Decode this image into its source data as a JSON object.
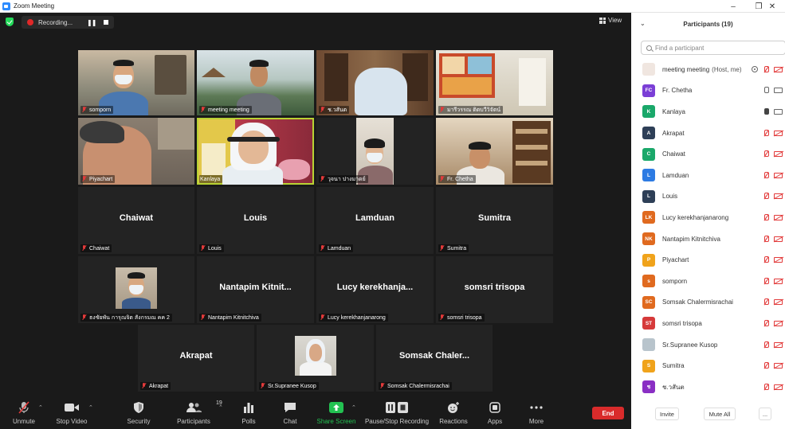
{
  "window": {
    "title": "Zoom Meeting"
  },
  "recording": {
    "label": "Recording..."
  },
  "view": {
    "label": "View"
  },
  "tiles": [
    {
      "name": "somporn",
      "video": true
    },
    {
      "name": "meeting meeting",
      "video": true
    },
    {
      "name": "ช.วสันต",
      "video": true
    },
    {
      "name": "มารีวรรณ  ติตบวีวิจัตน์",
      "video": true
    },
    {
      "name": "Piyachart",
      "video": true
    },
    {
      "name": "Kanlaya",
      "video": true,
      "active": true
    },
    {
      "name": "วุจนา ปางมาดย์",
      "video": true
    },
    {
      "name": "Fr. Chetha",
      "video": true
    },
    {
      "name": "Chaiwat",
      "display": "Chaiwat",
      "video": false
    },
    {
      "name": "Louis",
      "display": "Louis",
      "video": false
    },
    {
      "name": "Lamduan",
      "display": "Lamduan",
      "video": false
    },
    {
      "name": "Sumitra",
      "display": "Sumitra",
      "video": false
    },
    {
      "name": "ธงชัยพัน การุณจิต สังกรมณ คค 2",
      "video": true
    },
    {
      "name": "Nantapim Kitnitchiva",
      "display": "Nantapim  Kitnit...",
      "video": false
    },
    {
      "name": "Lucy kerekhanjanarong",
      "display": "Lucy  kerekhanja...",
      "video": false
    },
    {
      "name": "somsri trisopa",
      "display": "somsri trisopa",
      "video": false
    },
    {
      "name": "Akrapat",
      "display": "Akrapat",
      "video": false
    },
    {
      "name": "Sr.Supranee Kusop",
      "video": true
    },
    {
      "name": "Somsak Chalermisrachai",
      "display": "Somsak  Chaler...",
      "video": false
    }
  ],
  "toolbar": {
    "unmute": "Unmute",
    "stop_video": "Stop Video",
    "security": "Security",
    "participants": "Participants",
    "participants_count": "19",
    "polls": "Polls",
    "chat": "Chat",
    "share_screen": "Share Screen",
    "record": "Pause/Stop Recording",
    "reactions": "Reactions",
    "apps": "Apps",
    "more": "More",
    "end": "End"
  },
  "panel": {
    "title": "Participants (19)",
    "search_placeholder": "Find a participant",
    "participants": [
      {
        "name": "meeting meeting",
        "suffix": "(Host, me)",
        "initials": "",
        "color": "#f0e6e0",
        "mic": "muted",
        "cam": "off",
        "share": true
      },
      {
        "name": "Fr. Chetha",
        "initials": "FC",
        "color": "#7b3fd6",
        "mic": "on",
        "cam": "on"
      },
      {
        "name": "Kanlaya",
        "initials": "K",
        "color": "#1aa86a",
        "mic": "active",
        "cam": "on"
      },
      {
        "name": "Akrapat",
        "initials": "A",
        "color": "#2e3f57",
        "mic": "muted",
        "cam": "off"
      },
      {
        "name": "Chaiwat",
        "initials": "C",
        "color": "#1aa86a",
        "mic": "muted",
        "cam": "off"
      },
      {
        "name": "Lamduan",
        "initials": "L",
        "color": "#2d7be3",
        "mic": "muted",
        "cam": "off"
      },
      {
        "name": "Louis",
        "initials": "L",
        "color": "#2e3f57",
        "mic": "muted",
        "cam": "off"
      },
      {
        "name": "Lucy kerekhanjanarong",
        "initials": "LK",
        "color": "#e06a1f",
        "mic": "muted",
        "cam": "off"
      },
      {
        "name": "Nantapim Kitnitchiva",
        "initials": "NK",
        "color": "#e06a1f",
        "mic": "muted",
        "cam": "off"
      },
      {
        "name": "Piyachart",
        "initials": "P",
        "color": "#f0a31b",
        "mic": "muted",
        "cam": "off"
      },
      {
        "name": "somporn",
        "initials": "s",
        "color": "#e06a1f",
        "mic": "muted",
        "cam": "off"
      },
      {
        "name": "Somsak Chalermisrachai",
        "initials": "SC",
        "color": "#e06a1f",
        "mic": "muted",
        "cam": "off"
      },
      {
        "name": "somsri trisopa",
        "initials": "ST",
        "color": "#d63a3a",
        "mic": "muted",
        "cam": "off"
      },
      {
        "name": "Sr.Supranee Kusop",
        "initials": "",
        "color": "#b8c4cc",
        "mic": "muted",
        "cam": "off"
      },
      {
        "name": "Sumitra",
        "initials": "S",
        "color": "#f0a31b",
        "mic": "muted",
        "cam": "off"
      },
      {
        "name": "ช.วสันต",
        "initials": "ช",
        "color": "#8a2fc4",
        "mic": "muted",
        "cam": "off"
      }
    ],
    "invite": "Invite",
    "mute_all": "Mute All",
    "more": "..."
  }
}
